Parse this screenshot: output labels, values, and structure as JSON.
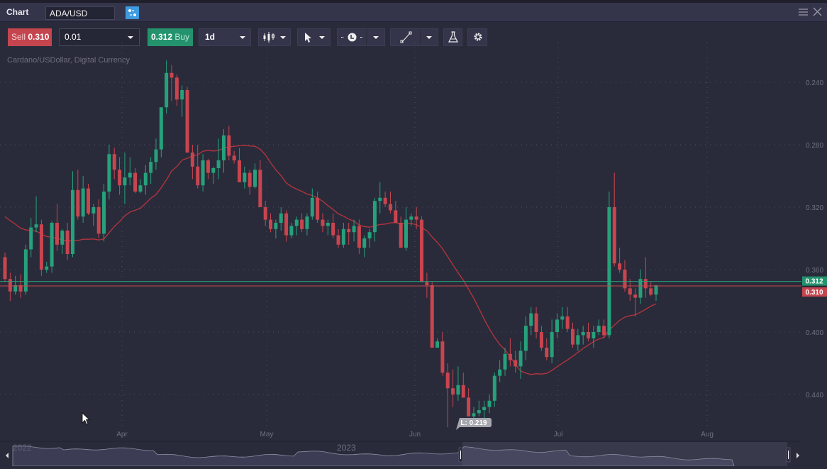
{
  "window": {
    "title": "Chart",
    "symbol": "ADA/USD"
  },
  "toolbar": {
    "sell_label": "Sell",
    "sell_price": "0.310",
    "quantity": "0.01",
    "buy_price": "0.312",
    "buy_label": "Buy",
    "timeframe": "1d",
    "icons": [
      "candlestick-chart-type-icon",
      "pointer-cursor-icon",
      "time-line-icon",
      "trend-line-draw-icon",
      "indicators-flask-icon",
      "settings-gear-icon"
    ]
  },
  "chart": {
    "description": "Cardano/USDollar, Digital Currency",
    "price_axis": [
      "0.440",
      "0.400",
      "0.360",
      "0.320",
      "0.280",
      "0.240"
    ],
    "time_axis": [
      "Apr",
      "May",
      "Jun",
      "Jul",
      "Aug"
    ],
    "buy_marker": "0.312",
    "sell_marker": "0.310",
    "low_label": "L: 0.219",
    "colors": {
      "up": "#26a17b",
      "down": "#c8454f",
      "ma": "#b8343d",
      "buy": "#24936d",
      "sell": "#c5454f"
    }
  },
  "navigator": {
    "year_left": "2022",
    "year_mid": "2023"
  },
  "chart_data": {
    "type": "candlestick",
    "title": "Cardano/USDollar, Digital Currency",
    "interval": "1d",
    "ylim": [
      0.215,
      0.46
    ],
    "yticks": [
      0.24,
      0.28,
      0.32,
      0.36,
      0.4,
      0.44
    ],
    "xticks": [
      "Apr",
      "May",
      "Jun",
      "Jul",
      "Aug"
    ],
    "series": [
      {
        "name": "ADA/USD",
        "ohlc": [
          [
            0.328,
            0.331,
            0.312,
            0.314
          ],
          [
            0.314,
            0.318,
            0.3,
            0.306
          ],
          [
            0.306,
            0.316,
            0.304,
            0.31
          ],
          [
            0.31,
            0.317,
            0.302,
            0.306
          ],
          [
            0.306,
            0.336,
            0.304,
            0.333
          ],
          [
            0.333,
            0.353,
            0.328,
            0.347
          ],
          [
            0.347,
            0.367,
            0.344,
            0.349
          ],
          [
            0.349,
            0.352,
            0.316,
            0.32
          ],
          [
            0.32,
            0.325,
            0.318,
            0.322
          ],
          [
            0.322,
            0.351,
            0.318,
            0.35
          ],
          [
            0.35,
            0.362,
            0.332,
            0.336
          ],
          [
            0.336,
            0.346,
            0.33,
            0.345
          ],
          [
            0.345,
            0.35,
            0.326,
            0.33
          ],
          [
            0.33,
            0.383,
            0.328,
            0.371
          ],
          [
            0.371,
            0.384,
            0.352,
            0.354
          ],
          [
            0.354,
            0.38,
            0.35,
            0.372
          ],
          [
            0.372,
            0.375,
            0.355,
            0.356
          ],
          [
            0.356,
            0.362,
            0.348,
            0.36
          ],
          [
            0.36,
            0.365,
            0.34,
            0.343
          ],
          [
            0.343,
            0.375,
            0.338,
            0.37
          ],
          [
            0.37,
            0.4,
            0.365,
            0.394
          ],
          [
            0.394,
            0.398,
            0.378,
            0.384
          ],
          [
            0.384,
            0.392,
            0.368,
            0.374
          ],
          [
            0.374,
            0.395,
            0.362,
            0.379
          ],
          [
            0.379,
            0.392,
            0.374,
            0.382
          ],
          [
            0.382,
            0.385,
            0.369,
            0.37
          ],
          [
            0.37,
            0.378,
            0.369,
            0.374
          ],
          [
            0.374,
            0.387,
            0.368,
            0.382
          ],
          [
            0.382,
            0.392,
            0.375,
            0.389
          ],
          [
            0.389,
            0.404,
            0.384,
            0.397
          ],
          [
            0.397,
            0.423,
            0.392,
            0.424
          ],
          [
            0.424,
            0.454,
            0.42,
            0.446
          ],
          [
            0.446,
            0.451,
            0.428,
            0.443
          ],
          [
            0.443,
            0.445,
            0.425,
            0.429
          ],
          [
            0.429,
            0.438,
            0.418,
            0.435
          ],
          [
            0.435,
            0.437,
            0.395,
            0.395
          ],
          [
            0.395,
            0.4,
            0.378,
            0.386
          ],
          [
            0.386,
            0.4,
            0.372,
            0.374
          ],
          [
            0.374,
            0.394,
            0.37,
            0.39
          ],
          [
            0.39,
            0.391,
            0.378,
            0.382
          ],
          [
            0.382,
            0.386,
            0.375,
            0.385
          ],
          [
            0.385,
            0.404,
            0.378,
            0.39
          ],
          [
            0.39,
            0.41,
            0.382,
            0.406
          ],
          [
            0.406,
            0.412,
            0.39,
            0.393
          ],
          [
            0.393,
            0.396,
            0.388,
            0.39
          ],
          [
            0.39,
            0.398,
            0.376,
            0.376
          ],
          [
            0.376,
            0.386,
            0.372,
            0.382
          ],
          [
            0.382,
            0.384,
            0.368,
            0.373
          ],
          [
            0.373,
            0.388,
            0.372,
            0.384
          ],
          [
            0.384,
            0.39,
            0.362,
            0.36
          ],
          [
            0.36,
            0.364,
            0.348,
            0.352
          ],
          [
            0.352,
            0.356,
            0.344,
            0.346
          ],
          [
            0.346,
            0.352,
            0.34,
            0.35
          ],
          [
            0.35,
            0.36,
            0.345,
            0.356
          ],
          [
            0.356,
            0.358,
            0.338,
            0.342
          ],
          [
            0.342,
            0.35,
            0.34,
            0.348
          ],
          [
            0.348,
            0.354,
            0.342,
            0.352
          ],
          [
            0.352,
            0.356,
            0.344,
            0.346
          ],
          [
            0.346,
            0.356,
            0.342,
            0.354
          ],
          [
            0.354,
            0.372,
            0.352,
            0.366
          ],
          [
            0.366,
            0.37,
            0.35,
            0.352
          ],
          [
            0.352,
            0.356,
            0.344,
            0.348
          ],
          [
            0.348,
            0.352,
            0.342,
            0.35
          ],
          [
            0.35,
            0.356,
            0.34,
            0.342
          ],
          [
            0.342,
            0.346,
            0.334,
            0.336
          ],
          [
            0.336,
            0.35,
            0.334,
            0.346
          ],
          [
            0.346,
            0.35,
            0.336,
            0.344
          ],
          [
            0.344,
            0.352,
            0.338,
            0.348
          ],
          [
            0.348,
            0.352,
            0.33,
            0.334
          ],
          [
            0.334,
            0.342,
            0.328,
            0.34
          ],
          [
            0.34,
            0.346,
            0.334,
            0.344
          ],
          [
            0.344,
            0.366,
            0.338,
            0.364
          ],
          [
            0.364,
            0.376,
            0.356,
            0.366
          ],
          [
            0.366,
            0.37,
            0.36,
            0.362
          ],
          [
            0.362,
            0.37,
            0.356,
            0.358
          ],
          [
            0.358,
            0.364,
            0.352,
            0.35
          ],
          [
            0.35,
            0.354,
            0.336,
            0.334
          ],
          [
            0.334,
            0.36,
            0.332,
            0.352
          ],
          [
            0.352,
            0.356,
            0.348,
            0.354
          ],
          [
            0.354,
            0.36,
            0.346,
            0.352
          ],
          [
            0.352,
            0.354,
            0.314,
            0.312
          ],
          [
            0.312,
            0.318,
            0.302,
            0.31
          ],
          [
            0.31,
            0.312,
            0.27,
            0.27
          ],
          [
            0.27,
            0.276,
            0.27,
            0.274
          ],
          [
            0.274,
            0.28,
            0.252,
            0.254
          ],
          [
            0.254,
            0.26,
            0.219,
            0.244
          ],
          [
            0.244,
            0.256,
            0.232,
            0.24
          ],
          [
            0.24,
            0.258,
            0.236,
            0.246
          ],
          [
            0.246,
            0.254,
            0.238,
            0.238
          ],
          [
            0.238,
            0.244,
            0.228,
            0.226
          ],
          [
            0.226,
            0.232,
            0.224,
            0.228
          ],
          [
            0.228,
            0.236,
            0.226,
            0.23
          ],
          [
            0.23,
            0.236,
            0.224,
            0.232
          ],
          [
            0.232,
            0.24,
            0.228,
            0.236
          ],
          [
            0.236,
            0.254,
            0.232,
            0.252
          ],
          [
            0.252,
            0.262,
            0.248,
            0.256
          ],
          [
            0.256,
            0.27,
            0.252,
            0.266
          ],
          [
            0.266,
            0.276,
            0.258,
            0.262
          ],
          [
            0.262,
            0.268,
            0.254,
            0.258
          ],
          [
            0.258,
            0.274,
            0.25,
            0.268
          ],
          [
            0.268,
            0.29,
            0.262,
            0.284
          ],
          [
            0.284,
            0.296,
            0.278,
            0.292
          ],
          [
            0.292,
            0.296,
            0.276,
            0.28
          ],
          [
            0.28,
            0.284,
            0.268,
            0.27
          ],
          [
            0.27,
            0.276,
            0.262,
            0.264
          ],
          [
            0.264,
            0.288,
            0.26,
            0.28
          ],
          [
            0.28,
            0.292,
            0.276,
            0.288
          ],
          [
            0.288,
            0.296,
            0.282,
            0.29
          ],
          [
            0.29,
            0.296,
            0.28,
            0.282
          ],
          [
            0.282,
            0.286,
            0.27,
            0.272
          ],
          [
            0.272,
            0.282,
            0.268,
            0.278
          ],
          [
            0.278,
            0.284,
            0.272,
            0.28
          ],
          [
            0.28,
            0.286,
            0.274,
            0.276
          ],
          [
            0.276,
            0.284,
            0.27,
            0.28
          ],
          [
            0.28,
            0.288,
            0.278,
            0.284
          ],
          [
            0.284,
            0.288,
            0.276,
            0.278
          ],
          [
            0.278,
            0.37,
            0.276,
            0.36
          ],
          [
            0.36,
            0.382,
            0.322,
            0.324
          ],
          [
            0.324,
            0.334,
            0.318,
            0.32
          ],
          [
            0.32,
            0.326,
            0.306,
            0.308
          ],
          [
            0.308,
            0.314,
            0.3,
            0.304
          ],
          [
            0.304,
            0.308,
            0.29,
            0.302
          ],
          [
            0.302,
            0.32,
            0.298,
            0.314
          ],
          [
            0.314,
            0.328,
            0.302,
            0.308
          ],
          [
            0.308,
            0.312,
            0.303,
            0.304
          ],
          [
            0.304,
            0.31,
            0.3,
            0.31
          ]
        ]
      },
      {
        "name": "Moving Average",
        "values": "smoothed line from ~0.359 (left) peaking ~0.390 in early May, declining to ~0.304 mid-July, then ~0.310"
      }
    ],
    "annotations": [
      {
        "text": "L: 0.219",
        "type": "low-marker"
      },
      {
        "text": "0.312",
        "type": "buy-price-line"
      },
      {
        "text": "0.310",
        "type": "sell-price-line"
      }
    ]
  }
}
